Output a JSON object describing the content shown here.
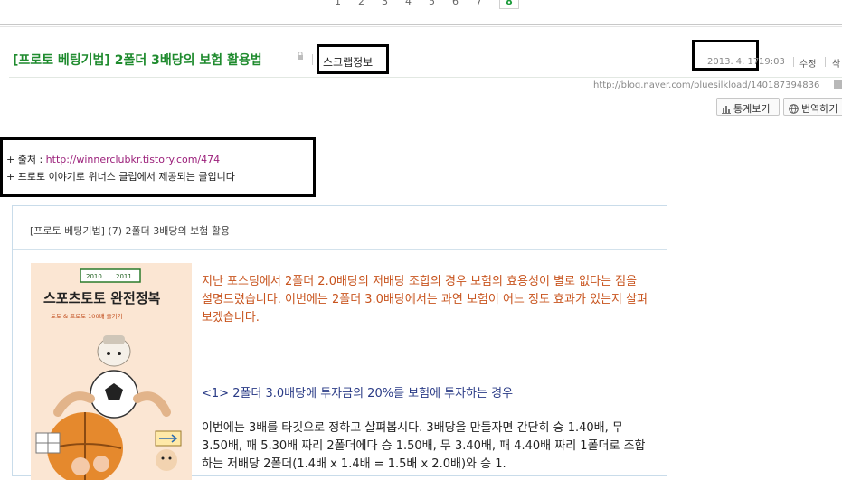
{
  "pagination": {
    "pages": [
      "1",
      "2",
      "3",
      "4",
      "5",
      "6",
      "7"
    ],
    "current": "8"
  },
  "post": {
    "title": "[프로토 베팅기법] 2폴더 3배당의 보험 활용법",
    "scrap_label": "스크랩정보",
    "date": "2013. 4. 17.",
    "time": "19:03",
    "edit_label": "수정",
    "delete_label": "삭",
    "url": "http://blog.naver.com/bluesilkload/140187394836"
  },
  "actions": {
    "stats_label": "통계보기",
    "translate_label": "번역하기"
  },
  "source": {
    "prefix": "+ 출처 : ",
    "link": "http://winnerclubkr.tistory.com/474",
    "note": "+ 프로토 이야기로 위너스 클럽에서 제공되는 글입니다"
  },
  "article": {
    "header": "[프로토 베팅기법] (7) 2폴더 3배당의 보험 활용",
    "book": {
      "year_left": "2010",
      "year_right": "2011",
      "title": "스포츠토토 완전정복",
      "subtitle": "토토 & 프로토 100배 즐기기"
    },
    "intro": "지난 포스팅에서 2폴더 2.0배당의 저배당 조합의 경우 보험의 효용성이 별로 없다는 점을 설명드렸습니다. 이번에는 2폴더 3.0배당에서는 과연 보험이 어느 정도 효과가 있는지 살펴보겠습니다.",
    "heading": "<1> 2폴더 3.0배당에 투자금의 20%를 보험에 투자하는 경우",
    "body": "이번에는 3배를 타깃으로 정하고 살펴봅시다. 3배당을 만들자면 간단히 승 1.40배, 무 3.50배, 패 5.30배 짜리 2폴더에다 승 1.50배, 무 3.40배, 패 4.40배 짜리 1폴더로 조합하는 저배당 2폴더(1.4배 x 1.4배 = 1.5배 x 2.0배)와 승 1."
  },
  "colors": {
    "title_green": "#1f8b2e",
    "intro_orange": "#c8541e",
    "heading_blue": "#2a3b86",
    "link_purple": "#9b1f7a"
  }
}
